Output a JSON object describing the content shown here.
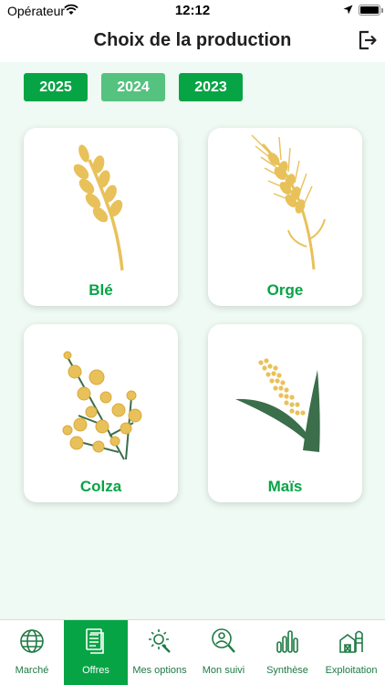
{
  "status": {
    "carrier": "Opérateur",
    "time": "12:12"
  },
  "header": {
    "title": "Choix de la production"
  },
  "years": [
    "2025",
    "2024",
    "2023"
  ],
  "cards": [
    {
      "label": "Blé",
      "icon": "wheat-icon"
    },
    {
      "label": "Orge",
      "icon": "barley-icon"
    },
    {
      "label": "Colza",
      "icon": "rapeseed-icon"
    },
    {
      "label": "Maïs",
      "icon": "corn-icon"
    }
  ],
  "tabs": [
    {
      "label": "Marché",
      "icon": "globe-icon"
    },
    {
      "label": "Offres",
      "icon": "documents-icon",
      "active": true
    },
    {
      "label": "Mes options",
      "icon": "gear-wrench-icon"
    },
    {
      "label": "Mon suivi",
      "icon": "user-search-icon"
    },
    {
      "label": "Synthèse",
      "icon": "bar-chart-icon"
    },
    {
      "label": "Exploitation",
      "icon": "farm-icon"
    }
  ],
  "colors": {
    "primary": "#07a445",
    "selected_year": "#55c27f",
    "background": "#eefaf3",
    "crop_yellow": "#e8c15a",
    "leaf_green": "#3b6e4a"
  }
}
